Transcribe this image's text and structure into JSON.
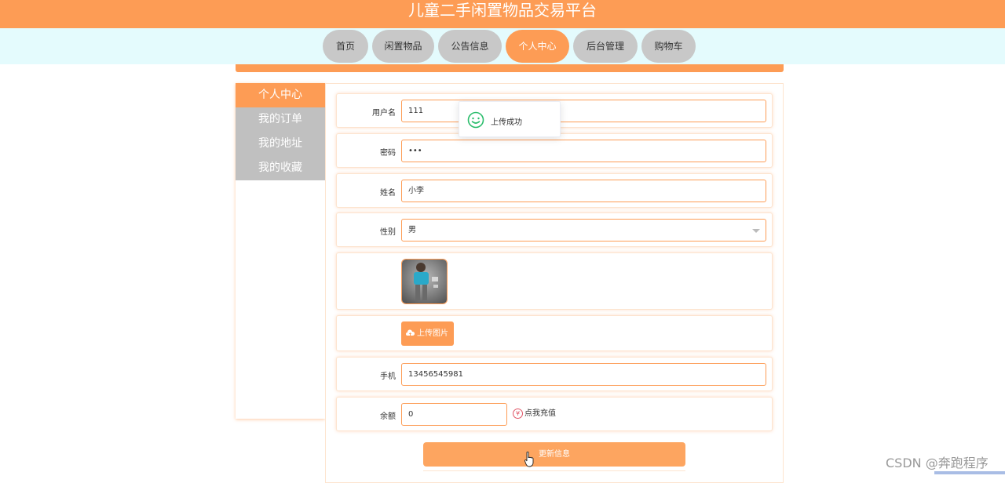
{
  "site": {
    "title": "儿童二手闲置物品交易平台"
  },
  "nav": {
    "items": [
      {
        "label": "首页",
        "active": false
      },
      {
        "label": "闲置物品",
        "active": false
      },
      {
        "label": "公告信息",
        "active": false
      },
      {
        "label": "个人中心",
        "active": true
      },
      {
        "label": "后台管理",
        "active": false
      },
      {
        "label": "购物车",
        "active": false
      }
    ]
  },
  "sidebar": {
    "items": [
      {
        "label": "个人中心",
        "active": true
      },
      {
        "label": "我的订单",
        "active": false
      },
      {
        "label": "我的地址",
        "active": false
      },
      {
        "label": "我的收藏",
        "active": false
      }
    ]
  },
  "form": {
    "username": {
      "label": "用户名",
      "value": "111"
    },
    "password": {
      "label": "密码",
      "value": "•••"
    },
    "name": {
      "label": "姓名",
      "value": "小李"
    },
    "gender": {
      "label": "性别",
      "value": "男"
    },
    "upload_label": "上传图片",
    "phone": {
      "label": "手机",
      "value": "13456545981"
    },
    "balance": {
      "label": "余额",
      "value": "0"
    },
    "recharge_label": "点我充值",
    "recharge_icon": "¥",
    "update_label": "更新信息"
  },
  "toast": {
    "message": "上传成功",
    "icon": "smile-icon"
  },
  "watermark": "CSDN @奔跑程序",
  "colors": {
    "accent": "#fd9c55",
    "nav_bg": "#e4fbfd",
    "inactive": "#c8c8c8",
    "success": "#2bbd6c"
  }
}
